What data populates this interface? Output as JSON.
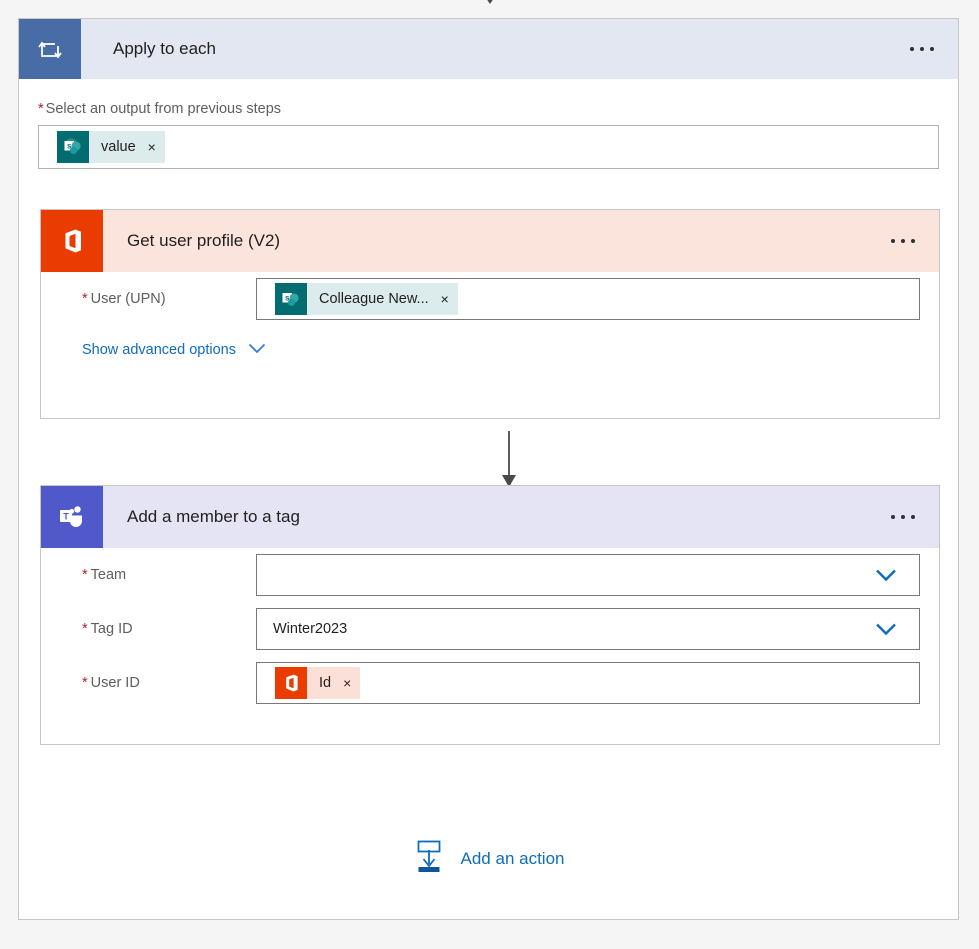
{
  "canvas": {
    "incoming_arrow": "arrow-down-icon"
  },
  "scope": {
    "icon": "loop-icon",
    "title": "Apply to each",
    "menu": "ellipsis-icon",
    "input_label": "Select an output from previous steps",
    "required_marker": "*",
    "token": {
      "icon": "sharepoint-icon",
      "text": "value",
      "remove": "×"
    }
  },
  "actions": [
    {
      "id": "get-user-profile",
      "icon": "office365-icon",
      "title": "Get user profile (V2)",
      "menu": "ellipsis-icon",
      "fields": [
        {
          "label": "User (UPN)",
          "required_marker": "*",
          "token": {
            "icon": "sharepoint-icon",
            "text": "Colleague New...",
            "remove": "×"
          }
        }
      ],
      "advanced_link": {
        "label": "Show advanced options",
        "icon": "chevron-down-icon"
      }
    },
    {
      "id": "add-member-to-tag",
      "icon": "teams-icon",
      "title": "Add a member to a tag",
      "menu": "ellipsis-icon",
      "fields": [
        {
          "label": "Team",
          "required_marker": "*",
          "value": "",
          "icon": "chevron-down-icon"
        },
        {
          "label": "Tag ID",
          "required_marker": "*",
          "value": "Winter2023",
          "icon": "chevron-down-icon"
        },
        {
          "label": "User ID",
          "required_marker": "*",
          "token": {
            "icon": "office365-icon",
            "text": "Id",
            "remove": "×"
          }
        }
      ]
    }
  ],
  "add_action": {
    "icon": "insert-action-icon",
    "label": "Add an action"
  },
  "colors": {
    "scope_icon": "#486CA5",
    "scope_header": "#E3E7F1",
    "office365": "#EB3C00",
    "office365_header": "#FBE4DC",
    "teams": "#5059C9",
    "teams_header": "#E5E4F4",
    "sharepoint": "#036C70",
    "link": "#0F6CBD",
    "required": "#A4262C"
  }
}
